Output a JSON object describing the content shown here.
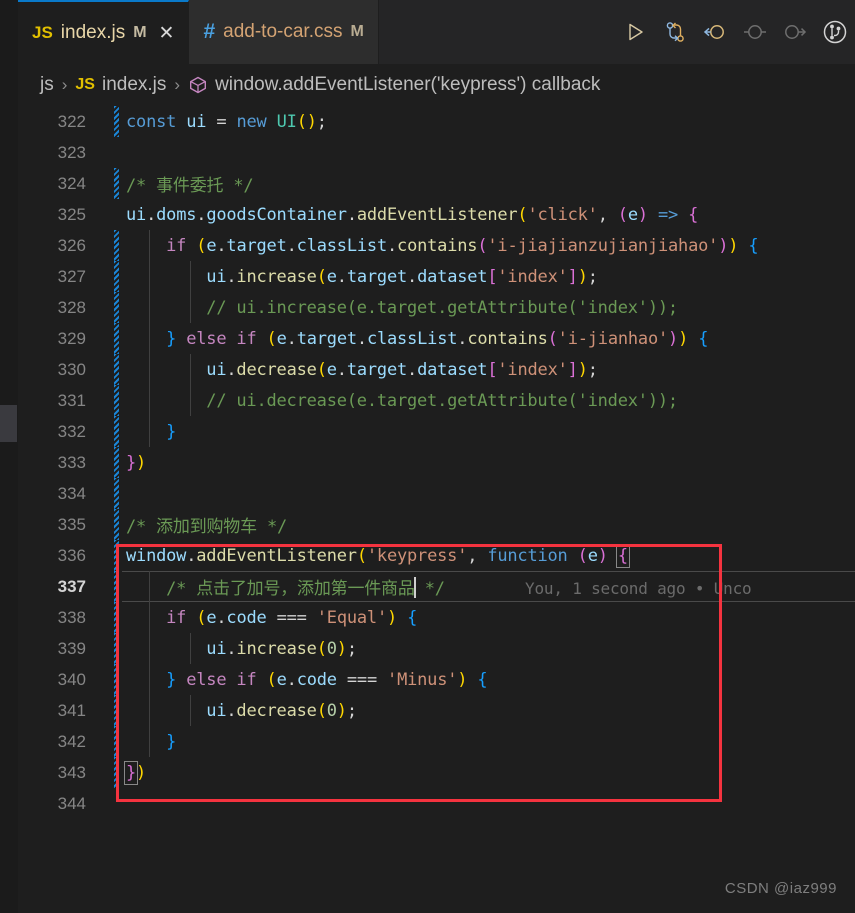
{
  "window": {
    "app": "Visual Studio Code",
    "theme_bg": "#1e1e1e",
    "accent": "#0a7aca",
    "annotation_color": "#f5333f"
  },
  "tabs": [
    {
      "icon": "js-file-icon",
      "icon_label": "JS",
      "name": "index.js",
      "dirty_flag": "M",
      "close_label": "✕",
      "active": true
    },
    {
      "icon": "css-file-icon",
      "icon_label": "#",
      "name": "add-to-car.css",
      "dirty_flag": "M",
      "close_label": "",
      "active": false
    }
  ],
  "toolbar": {
    "items": [
      {
        "name": "run-button",
        "label": "Run"
      },
      {
        "name": "run-and-debug-button",
        "label": "Run and Debug"
      },
      {
        "name": "step-back-button",
        "label": "Step Back"
      },
      {
        "name": "step-over-button",
        "label": "Step Over"
      },
      {
        "name": "step-into-button",
        "label": "Step Into"
      },
      {
        "name": "source-control-button",
        "label": "Source Control"
      }
    ]
  },
  "breadcrumbs": {
    "separator": "›",
    "items": [
      {
        "label": "js",
        "icon": ""
      },
      {
        "label": "index.js",
        "icon": "js-file-icon",
        "icon_label": "JS"
      },
      {
        "label": "window.addEventListener('keypress') callback",
        "icon": "symbol-function-icon"
      }
    ]
  },
  "editor": {
    "first_line": 322,
    "current_line": 337,
    "blame": "You, 1 second ago • Unco",
    "lines": [
      {
        "n": 322,
        "gutter": true
      },
      {
        "n": 323,
        "gutter": false
      },
      {
        "n": 324,
        "gutter": true
      },
      {
        "n": 325,
        "gutter": false
      },
      {
        "n": 326,
        "gutter": true
      },
      {
        "n": 327,
        "gutter": true
      },
      {
        "n": 328,
        "gutter": true
      },
      {
        "n": 329,
        "gutter": true
      },
      {
        "n": 330,
        "gutter": true
      },
      {
        "n": 331,
        "gutter": true
      },
      {
        "n": 332,
        "gutter": true
      },
      {
        "n": 333,
        "gutter": true
      },
      {
        "n": 334,
        "gutter": true
      },
      {
        "n": 335,
        "gutter": true
      },
      {
        "n": 336,
        "gutter": true
      },
      {
        "n": 337,
        "gutter": true
      },
      {
        "n": 338,
        "gutter": true
      },
      {
        "n": 339,
        "gutter": true
      },
      {
        "n": 340,
        "gutter": true
      },
      {
        "n": 341,
        "gutter": true
      },
      {
        "n": 342,
        "gutter": true
      },
      {
        "n": 343,
        "gutter": true
      },
      {
        "n": 344,
        "gutter": false
      }
    ],
    "source_text": [
      "const ui = new UI();",
      "",
      "/* 事件委托 */",
      "ui.doms.goodsContainer.addEventListener('click', (e) => {",
      "    if (e.target.classList.contains('i-jiajianzujianjiahao')) {",
      "        ui.increase(e.target.dataset['index']);",
      "        // ui.increase(e.target.getAttribute('index'));",
      "    } else if (e.target.classList.contains('i-jianhao')) {",
      "        ui.decrease(e.target.dataset['index']);",
      "        // ui.decrease(e.target.getAttribute('index'));",
      "    }",
      "})",
      "",
      "/* 添加到购物车 */",
      "window.addEventListener('keypress', function (e) {",
      "    /* 点击了加号，添加第一件商品 */",
      "    if (e.code === 'Equal') {",
      "        ui.increase(0);",
      "    } else if (e.code === 'Minus') {",
      "        ui.decrease(0);",
      "    }",
      "})",
      ""
    ]
  },
  "annotation": {
    "name": "red-highlight-box",
    "covers_lines": "336-343"
  },
  "watermark": {
    "text": "CSDN @iaz999"
  }
}
